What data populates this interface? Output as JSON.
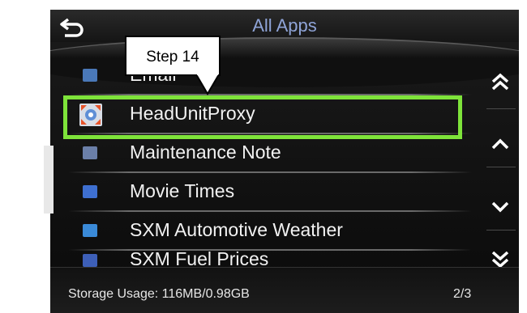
{
  "header": {
    "title": "All Apps",
    "back_icon": "back-arrow-icon"
  },
  "apps": [
    {
      "label": "Email",
      "icon": "email-icon",
      "color": "#4a78b8"
    },
    {
      "label": "HeadUnitProxy",
      "icon": "proxy-target-icon",
      "color": "#e8542a"
    },
    {
      "label": "Maintenance Note",
      "icon": "note-icon",
      "color": "#6b7fa8"
    },
    {
      "label": "Movie Times",
      "icon": "film-icon",
      "color": "#3e6fd0"
    },
    {
      "label": "SXM Automotive Weather",
      "icon": "weather-icon",
      "color": "#3a8ad8"
    },
    {
      "label": "SXM Fuel Prices",
      "icon": "fuel-icon",
      "color": "#3d5fb8"
    }
  ],
  "scroll": {
    "page_up_icon": "double-chevron-up-icon",
    "up_icon": "chevron-up-icon",
    "down_icon": "chevron-down-icon",
    "page_down_icon": "double-chevron-down-icon"
  },
  "footer": {
    "storage": "Storage Usage: 116MB/0.98GB",
    "page": "2/3"
  },
  "annotation": {
    "callout": "Step 14",
    "highlight_color": "#7ee33a"
  }
}
